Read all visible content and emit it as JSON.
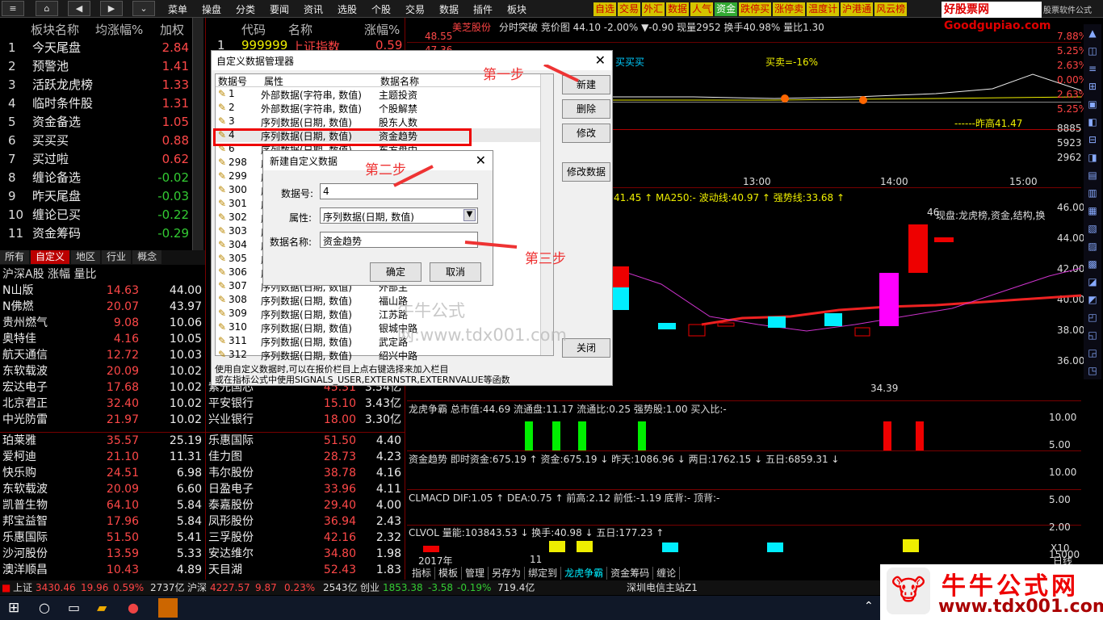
{
  "toolbar": {
    "menu": [
      "菜单",
      "操盘",
      "分类",
      "要闻",
      "资讯",
      "选股",
      "个股",
      "交易",
      "数据",
      "插件",
      "板块"
    ],
    "quick": [
      "自选",
      "交易",
      "外汇",
      "数据",
      "人气",
      "资金",
      "跌停买",
      "涨停卖",
      "温度计",
      "沪港通",
      "风云榜"
    ],
    "brand": "好股票网Goodgupiao.com",
    "brand2": "股票软件公式"
  },
  "left_panel": {
    "headers": [
      "板块名称",
      "均涨幅%",
      "加权"
    ],
    "rows": [
      {
        "n": "1",
        "name": "今天尾盘",
        "v": "2.84"
      },
      {
        "n": "2",
        "name": "预警池",
        "v": "1.41"
      },
      {
        "n": "3",
        "name": "活跃龙虎榜",
        "v": "1.33"
      },
      {
        "n": "4",
        "name": "临时条件股",
        "v": "1.31"
      },
      {
        "n": "5",
        "name": "资金备选",
        "v": "1.05"
      },
      {
        "n": "6",
        "name": "买买买",
        "v": "0.88"
      },
      {
        "n": "7",
        "name": "买过啦",
        "v": "0.62"
      },
      {
        "n": "8",
        "name": "缠论备选",
        "v": "-0.02"
      },
      {
        "n": "9",
        "name": "昨天尾盘",
        "v": "-0.03"
      },
      {
        "n": "10",
        "name": "缠论已买",
        "v": "-0.22"
      },
      {
        "n": "11",
        "name": "资金筹码",
        "v": "-0.29"
      }
    ],
    "tabs": [
      "所有",
      "自定义",
      "地区",
      "行业",
      "概念"
    ],
    "sub_header": "沪深A股 涨幅 量比",
    "stocks": [
      {
        "name": "N山版",
        "p": "14.63",
        "c": "44.00"
      },
      {
        "name": "N佛燃",
        "p": "20.07",
        "c": "43.97"
      },
      {
        "name": "贵州燃气",
        "p": "9.08",
        "c": "10.06"
      },
      {
        "name": "奥特佳",
        "p": "4.16",
        "c": "10.05"
      },
      {
        "name": "航天通信",
        "p": "12.72",
        "c": "10.03"
      },
      {
        "name": "东软载波",
        "p": "20.09",
        "c": "10.02"
      },
      {
        "name": "宏达电子",
        "p": "17.68",
        "c": "10.02"
      },
      {
        "name": "北京君正",
        "p": "32.40",
        "c": "10.02"
      },
      {
        "name": "中光防雷",
        "p": "21.97",
        "c": "10.02"
      }
    ],
    "stocks2": [
      {
        "name": "珀莱雅",
        "p": "35.57",
        "c": "25.19"
      },
      {
        "name": "爱柯迪",
        "p": "21.10",
        "c": "11.31"
      },
      {
        "name": "快乐购",
        "p": "24.51",
        "c": "6.98"
      },
      {
        "name": "东软载波",
        "p": "20.09",
        "c": "6.60"
      },
      {
        "name": "凯普生物",
        "p": "64.10",
        "c": "5.84"
      },
      {
        "name": "邦宝益智",
        "p": "17.96",
        "c": "5.84"
      },
      {
        "name": "乐惠国际",
        "p": "51.50",
        "c": "5.41"
      },
      {
        "name": "沙河股份",
        "p": "13.59",
        "c": "5.33"
      },
      {
        "name": "澳洋顺昌",
        "p": "10.43",
        "c": "4.89"
      }
    ]
  },
  "mid_panel": {
    "headers": [
      "代码",
      "名称",
      "涨幅%"
    ],
    "first": {
      "n": "1",
      "code": "999999",
      "name": "上证指数",
      "v": "0.59"
    },
    "rows2": [
      {
        "name": "紫光国芯",
        "p": "45.31",
        "c": "3.54亿"
      },
      {
        "name": "平安银行",
        "p": "15.10",
        "c": "3.43亿"
      },
      {
        "name": "兴业银行",
        "p": "18.00",
        "c": "3.30亿"
      }
    ],
    "rows3": [
      {
        "name": "乐惠国际",
        "p": "51.50",
        "c": "4.40"
      },
      {
        "name": "佳力图",
        "p": "28.73",
        "c": "4.23"
      },
      {
        "name": "韦尔股份",
        "p": "38.78",
        "c": "4.16"
      },
      {
        "name": "日盈电子",
        "p": "33.96",
        "c": "4.11"
      },
      {
        "name": "泰嘉股份",
        "p": "29.40",
        "c": "4.00"
      },
      {
        "name": "凤形股份",
        "p": "36.94",
        "c": "2.43"
      },
      {
        "name": "三孚股份",
        "p": "42.16",
        "c": "2.32"
      },
      {
        "name": "安达维尔",
        "p": "34.80",
        "c": "1.98"
      },
      {
        "name": "天目湖",
        "p": "52.43",
        "c": "1.83"
      }
    ]
  },
  "dialog": {
    "title": "自定义数据管理器",
    "cols": [
      "数据号",
      "属性",
      "数据名称"
    ],
    "items": [
      {
        "id": "1",
        "attr": "外部数据(字符串, 数值)",
        "name": "主题投资"
      },
      {
        "id": "2",
        "attr": "外部数据(字符串, 数值)",
        "name": "个股解禁"
      },
      {
        "id": "3",
        "attr": "序列数据(日期, 数值)",
        "name": "股东人数"
      },
      {
        "id": "4",
        "attr": "序列数据(日期, 数值)",
        "name": "资金趋势"
      },
      {
        "id": "6",
        "attr": "序列数据(日期, 数值)",
        "name": "东方盘中"
      },
      {
        "id": "298",
        "attr": "序",
        "name": ""
      },
      {
        "id": "299",
        "attr": "序",
        "name": ""
      },
      {
        "id": "300",
        "attr": "序",
        "name": ""
      },
      {
        "id": "301",
        "attr": "序",
        "name": ""
      },
      {
        "id": "302",
        "attr": "序",
        "name": ""
      },
      {
        "id": "303",
        "attr": "序",
        "name": ""
      },
      {
        "id": "304",
        "attr": "序",
        "name": ""
      },
      {
        "id": "305",
        "attr": "序",
        "name": ""
      },
      {
        "id": "306",
        "attr": "序",
        "name": ""
      },
      {
        "id": "307",
        "attr": "序列数据(日期, 数值)",
        "name": "外部主"
      },
      {
        "id": "308",
        "attr": "序列数据(日期, 数值)",
        "name": "福山路"
      },
      {
        "id": "309",
        "attr": "序列数据(日期, 数值)",
        "name": "江苏路"
      },
      {
        "id": "310",
        "attr": "序列数据(日期, 数值)",
        "name": "银城中路"
      },
      {
        "id": "311",
        "attr": "序列数据(日期, 数值)",
        "name": "武定路"
      },
      {
        "id": "312",
        "attr": "序列数据(日期, 数值)",
        "name": "绍兴中路"
      }
    ],
    "buttons": [
      "新建",
      "删除",
      "修改",
      "修改数据",
      "关闭"
    ],
    "note1": "使用自定义数据时,可以在报价栏目上点右键选择来加入栏目",
    "note2": "或在指标公式中使用SIGNALS_USER,EXTERNSTR,EXTERNVALUE等函数",
    "watermark": "牛牛公式网:www.tdx001.com"
  },
  "subdialog": {
    "title": "新建自定义数据",
    "id_label": "数据号:",
    "id_value": "4",
    "attr_label": "属性:",
    "attr_value": "序列数据(日期, 数值)",
    "name_label": "数据名称:",
    "name_value": "资金趋势",
    "ok": "确定",
    "cancel": "取消"
  },
  "annotations": {
    "s1": "第一步",
    "s2": "第二步",
    "s3": "第三步"
  },
  "chart": {
    "title": "美芝股份",
    "info": "分时突破 竞价图 44.10 -2.00% ▼-0.90 现量2952 换手40.98% 量比1.30",
    "top_prices": [
      "48.55",
      "47.36"
    ],
    "pct": [
      "7.88%",
      "5.25%",
      "2.63%",
      "0.00%",
      "2.63%",
      "5.25%"
    ],
    "vol": [
      "8885",
      "5923",
      "2962"
    ],
    "times": [
      "13:00",
      "14:00",
      "15:00"
    ],
    "zuogao": "------昨高41.47",
    "ybar": "买买买",
    "bc": "买卖=-16%",
    "k_info": "41.45 ↑ MA250:- 波动线:40.97 ↑ 强势线:33.68 ↑",
    "k_right": "现盘:龙虎榜,资金,结构,换",
    "k_prices": [
      "46.00",
      "44.00",
      "42.00",
      "40.00",
      "38.00",
      "36.00"
    ],
    "low": "34.39",
    "high": "46",
    "lh": "龙虎争霸 总市值:44.69 流通盘:11.17 流通比:0.25 强势股:1.00 买入比:-",
    "zj": "资金趋势 即时资金:675.19 ↑ 资金:675.19 ↓ 昨天:1086.96 ↓ 两日:1762.15 ↓ 五日:6859.31 ↓",
    "macd": "CLMACD DIF:1.05 ↑ DEA:0.75 ↑ 前高:2.12 前低:-1.19 底背:- 顶背:-",
    "vol2": "CLVOL 量能:103843.53 ↓ 换手:40.98 ↓ 五日:177.23 ↑",
    "ind_prices": [
      "10.00",
      "5.00",
      "10.00",
      "5.00",
      "2.00",
      "15000"
    ],
    "year": "2017年",
    "month": "11",
    "x10": "X10",
    "dayline": "日线",
    "btabs": [
      "指标",
      "模板",
      "管理",
      "另存为",
      "绑定到",
      "龙虎争霸",
      "资金筹码",
      "缠论"
    ]
  },
  "status": {
    "sh_label": "上证",
    "sh": "3430.46",
    "sh_c": "19.96",
    "sh_p": "0.59%",
    "sh_v": "2737亿",
    "sz_label": "沪深",
    "sz": "4227.57",
    "sz_c": "9.87",
    "sz_p": "0.23%",
    "sz_v": "2543亿",
    "cy_label": "创业",
    "cy": "1853.38",
    "cy_c": "-3.58",
    "cy_p": "-0.19%",
    "cy_v": "719.4亿",
    "station": "深圳电信主站Z1"
  },
  "watermark": {
    "text": "牛牛公式网",
    "url": "www.tdx001.com"
  }
}
